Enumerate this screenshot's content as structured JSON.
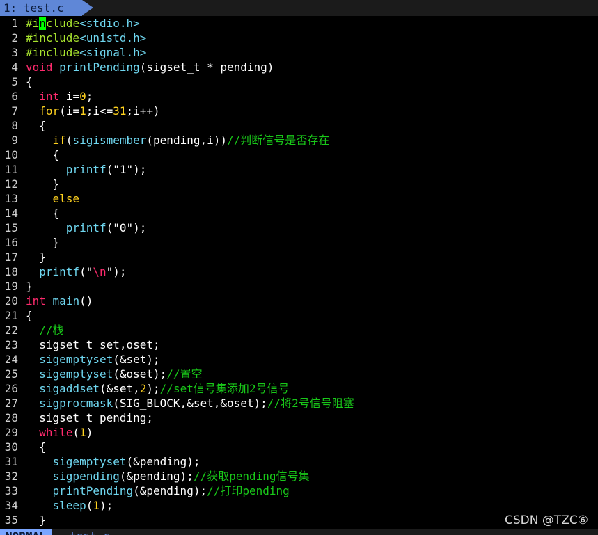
{
  "tab": {
    "label": "1: test.c"
  },
  "status": {
    "mode": "NORMAL",
    "file": "test.c"
  },
  "watermark": "CSDN @TZC⑥",
  "colors": {
    "keyword": "#ff2a6d",
    "control": "#ffd21f",
    "preprocessor": "#a7e22e",
    "function": "#6fd7f0",
    "comment": "#19c819",
    "cursor": "#00ff00",
    "tab": "#5f87d7"
  },
  "lines": [
    {
      "n": "1",
      "code": "#include<stdio.h>"
    },
    {
      "n": "2",
      "code": "#include<unistd.h>"
    },
    {
      "n": "3",
      "code": "#include<signal.h>"
    },
    {
      "n": "4",
      "code": "void printPending(sigset_t * pending)"
    },
    {
      "n": "5",
      "code": "{"
    },
    {
      "n": "6",
      "code": "  int i=0;"
    },
    {
      "n": "7",
      "code": "  for(i=1;i<=31;i++)"
    },
    {
      "n": "8",
      "code": "  {"
    },
    {
      "n": "9",
      "code": "    if(sigismember(pending,i))//判断信号是否存在"
    },
    {
      "n": "10",
      "code": "    {"
    },
    {
      "n": "11",
      "code": "      printf(\"1\");"
    },
    {
      "n": "12",
      "code": "    }"
    },
    {
      "n": "13",
      "code": "    else"
    },
    {
      "n": "14",
      "code": "    {"
    },
    {
      "n": "15",
      "code": "      printf(\"0\");"
    },
    {
      "n": "16",
      "code": "    }"
    },
    {
      "n": "17",
      "code": "  }"
    },
    {
      "n": "18",
      "code": "  printf(\"\\n\");"
    },
    {
      "n": "19",
      "code": "}"
    },
    {
      "n": "20",
      "code": "int main()"
    },
    {
      "n": "21",
      "code": "{"
    },
    {
      "n": "22",
      "code": "  //栈"
    },
    {
      "n": "23",
      "code": "  sigset_t set,oset;"
    },
    {
      "n": "24",
      "code": "  sigemptyset(&set);"
    },
    {
      "n": "25",
      "code": "  sigemptyset(&oset);//置空"
    },
    {
      "n": "26",
      "code": "  sigaddset(&set,2);//set信号集添加2号信号"
    },
    {
      "n": "27",
      "code": "  sigprocmask(SIG_BLOCK,&set,&oset);//将2号信号阻塞"
    },
    {
      "n": "28",
      "code": "  sigset_t pending;"
    },
    {
      "n": "29",
      "code": "  while(1)"
    },
    {
      "n": "30",
      "code": "  {"
    },
    {
      "n": "31",
      "code": "    sigemptyset(&pending);"
    },
    {
      "n": "32",
      "code": "    sigpending(&pending);//获取pending信号集"
    },
    {
      "n": "33",
      "code": "    printPending(&pending);//打印pending"
    },
    {
      "n": "34",
      "code": "    sleep(1);"
    },
    {
      "n": "35",
      "code": "  }"
    }
  ]
}
